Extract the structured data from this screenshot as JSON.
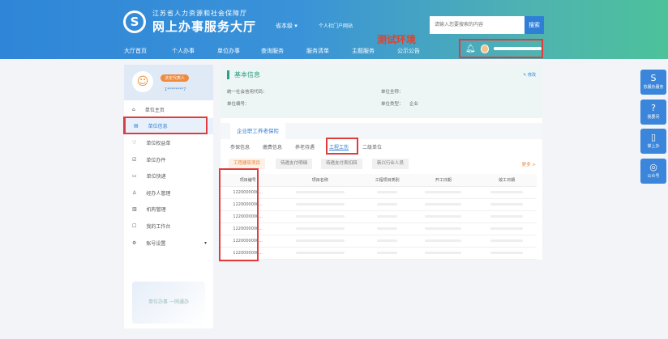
{
  "header": {
    "logo": "S",
    "org": "江苏省人力资源和社会保障厅",
    "title": "网上办事服务大厅",
    "region": "省本级 ▾",
    "portal": "个人社门户网站",
    "search_placeholder": "请输入您要搜索的内容",
    "search_button": "搜索",
    "env_label": "测试环境",
    "nav": [
      "大厅首页",
      "个人办事",
      "单位办事",
      "查询服务",
      "服务清单",
      "主题服务",
      "公示公告"
    ]
  },
  "sidebar": {
    "badge": "法定代表人",
    "phone": "1********7",
    "items": [
      {
        "icon": "⌂",
        "label": "单位主页"
      },
      {
        "icon": "▤",
        "label": "单位信息"
      },
      {
        "icon": "♡",
        "label": "单位权益单"
      },
      {
        "icon": "☑",
        "label": "单位办件"
      },
      {
        "icon": "▭",
        "label": "单位快递"
      },
      {
        "icon": "♙",
        "label": "经办人管理"
      },
      {
        "icon": "▥",
        "label": "机构管理"
      },
      {
        "icon": "☐",
        "label": "我的工作台"
      },
      {
        "icon": "⚙",
        "label": "账号设置"
      }
    ],
    "illustration_text": "单位办事 一网通办"
  },
  "main": {
    "section_title": "基本信息",
    "edit": "✎ 修改",
    "fields": {
      "credit_code": "统一社会信用代码：",
      "full_name": "单位全称：",
      "unit_no": "单位编号：",
      "unit_type": "单位类型：",
      "unit_type_value": "企业"
    },
    "tab": "企业职工养老保险",
    "subtabs": [
      "参保信息",
      "缴费信息",
      "养老待遇",
      "工程工伤",
      "二级单位"
    ],
    "chips": [
      "工程建筑项目",
      "待遇支付明细",
      "待遇支付表扣回",
      "新兴行业人员"
    ],
    "more": "更多 >",
    "table": {
      "headers": [
        "项目编号",
        "项目名称",
        "工程项目类别",
        "开工日期",
        "竣工日期"
      ],
      "rows": [
        "1220000000...",
        "1220000000...",
        "1220000000...",
        "1220000000...",
        "1220000000...",
        "1220000000..."
      ]
    }
  },
  "right": [
    {
      "icon": "S",
      "label": "苏服办服务"
    },
    {
      "icon": "?",
      "label": "我要问"
    },
    {
      "icon": "▯",
      "label": "掌上办"
    },
    {
      "icon": "◎",
      "label": "公众号"
    }
  ]
}
